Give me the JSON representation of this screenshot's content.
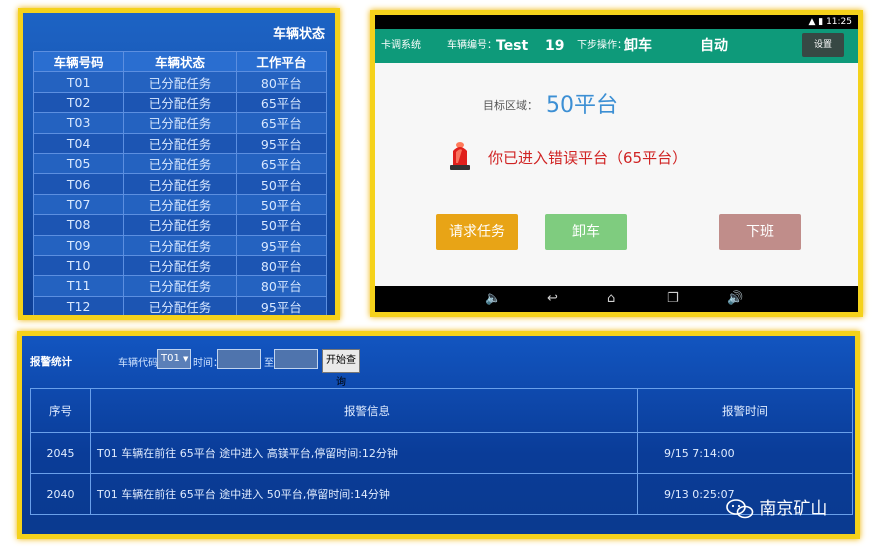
{
  "vehicle_status": {
    "title": "车辆状态",
    "columns": [
      "车辆号码",
      "车辆状态",
      "工作平台"
    ],
    "rows": [
      [
        "T01",
        "已分配任务",
        "80平台"
      ],
      [
        "T02",
        "已分配任务",
        "65平台"
      ],
      [
        "T03",
        "已分配任务",
        "65平台"
      ],
      [
        "T04",
        "已分配任务",
        "95平台"
      ],
      [
        "T05",
        "已分配任务",
        "65平台"
      ],
      [
        "T06",
        "已分配任务",
        "50平台"
      ],
      [
        "T07",
        "已分配任务",
        "50平台"
      ],
      [
        "T08",
        "已分配任务",
        "50平台"
      ],
      [
        "T09",
        "已分配任务",
        "95平台"
      ],
      [
        "T10",
        "已分配任务",
        "80平台"
      ],
      [
        "T11",
        "已分配任务",
        "80平台"
      ],
      [
        "T12",
        "已分配任务",
        "95平台"
      ]
    ]
  },
  "tablet": {
    "status_time": "11:25",
    "app_name": "卡调系统",
    "vehicle_no_label": "车辆编号：",
    "vehicle_no": "Test",
    "vehicle_count": "19",
    "next_op_label": "下步操作：",
    "next_op": "卸车",
    "mode": "自动",
    "settings_button": "设置",
    "target_label": "目标区域：",
    "target_value": "50平台",
    "alarm_message": "你已进入错误平台（65平台）",
    "buttons": {
      "request_task": "请求任务",
      "unload": "卸车",
      "off_duty": "下班"
    },
    "colors": {
      "app_bar": "#0e9a7a",
      "request_task": "#e8a416",
      "unload": "#7fcc7f",
      "off_duty": "#c08d8a",
      "target": "#3c8fd4",
      "alarm": "#d02424"
    }
  },
  "alarm_stats": {
    "title": "报警统计",
    "vehicle_code_label": "车辆代码：",
    "vehicle_code_value": "T01",
    "time_label": "时间：",
    "to_label": "至",
    "query_button": "开始查询",
    "columns": [
      "序号",
      "报警信息",
      "报警时间"
    ],
    "rows": [
      [
        "2045",
        "T01 车辆在前往 65平台 途中进入 高镁平台,停留时间:12分钟",
        "9/15 7:14:00"
      ],
      [
        "2040",
        "T01 车辆在前往 65平台 途中进入 50平台,停留时间:14分钟",
        "9/13 0:25:07"
      ]
    ]
  },
  "watermark": "南京矿山"
}
